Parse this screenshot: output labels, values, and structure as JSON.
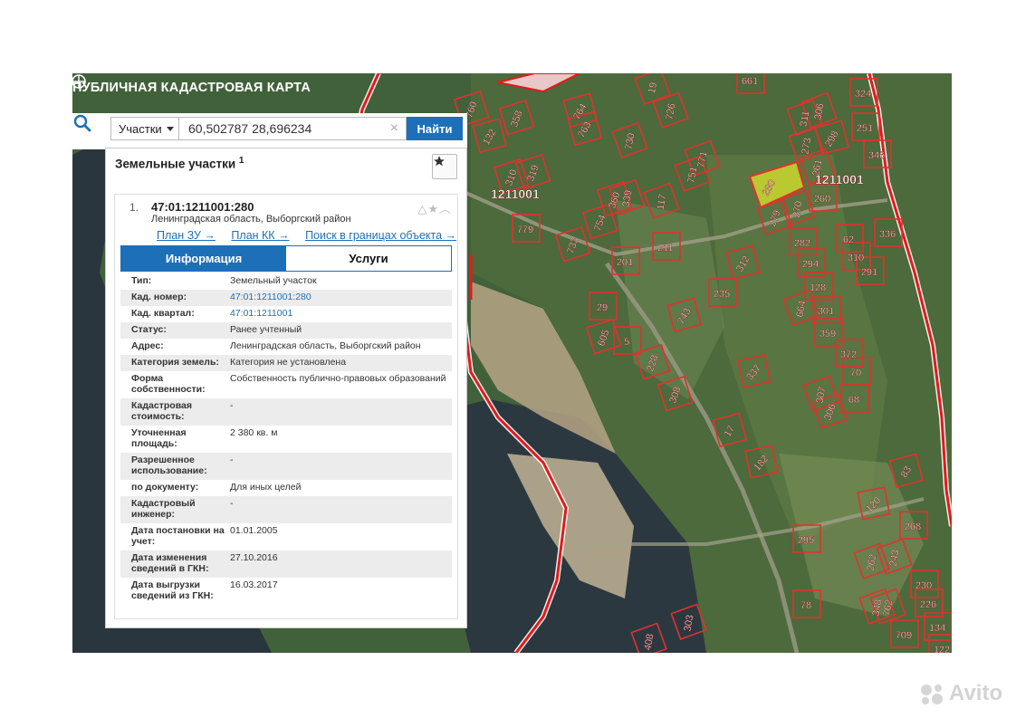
{
  "header": {
    "title": "ПУБЛИЧНАЯ КАДАСТРОВАЯ КАРТА"
  },
  "search": {
    "type_label": "Участки",
    "query": "60,502787 28,696234",
    "clear_symbol": "×",
    "find_label": "Найти"
  },
  "panel": {
    "title": "Земельные участки",
    "count": "1",
    "item": {
      "index": "1.",
      "cadastral_number": "47:01:1211001:280",
      "region": "Ленинградская область, Выборгский район",
      "links": [
        "План ЗУ →",
        "План КК →",
        "Поиск в границах объекта →"
      ]
    },
    "tabs": [
      "Информация",
      "Услуги"
    ],
    "rows": [
      {
        "k": "Тип:",
        "v": "Земельный участок"
      },
      {
        "k": "Кад. номер:",
        "v": "47:01:1211001:280"
      },
      {
        "k": "Кад. квартал:",
        "v": "47:01:1211001"
      },
      {
        "k": "Статус:",
        "v": "Ранее учтенный"
      },
      {
        "k": "Адрес:",
        "v": "Ленинградская область, Выборгский район"
      },
      {
        "k": "Категория земель:",
        "v": "Категория не установлена"
      },
      {
        "k": "Форма собственности:",
        "v": "Собственность публично-правовых образований"
      },
      {
        "k": "Кадастровая стоимость:",
        "v": "-"
      },
      {
        "k": "Уточненная площадь:",
        "v": "2 380 кв. м"
      },
      {
        "k": "Разрешенное использование:",
        "v": "-"
      },
      {
        "k": "по документу:",
        "v": "Для иных целей"
      },
      {
        "k": "Кадастровый инженер:",
        "v": "-"
      },
      {
        "k": "Дата постановки на учет:",
        "v": "01.01.2005"
      },
      {
        "k": "Дата изменения сведений в ГКН:",
        "v": "27.10.2016"
      },
      {
        "k": "Дата выгрузки сведений из ГКН:",
        "v": "16.03.2017"
      }
    ]
  },
  "map": {
    "block_labels": [
      "1211001",
      "1211001"
    ],
    "selected_parcel": "280",
    "parcel_labels": [
      "661",
      "19",
      "726",
      "764",
      "763",
      "730",
      "771",
      "751",
      "760",
      "132",
      "358",
      "310",
      "319",
      "779",
      "754",
      "360",
      "339",
      "117",
      "733",
      "211",
      "201",
      "312",
      "29",
      "235",
      "743",
      "605",
      "5",
      "228",
      "308",
      "337",
      "17",
      "182",
      "324",
      "311",
      "306",
      "251",
      "273",
      "298",
      "346",
      "261",
      "260",
      "279",
      "270",
      "282",
      "62",
      "336",
      "294",
      "310",
      "291",
      "128",
      "664",
      "301",
      "359",
      "372",
      "70",
      "307",
      "68",
      "306",
      "83",
      "120",
      "268",
      "295",
      "78",
      "262",
      "243",
      "230",
      "348",
      "226",
      "134",
      "709",
      "762",
      "303",
      "408",
      "122"
    ],
    "colors": {
      "parcel_outline": "#e0322e",
      "boundary": "#e21a1a",
      "selected_fill": "#d9e62a",
      "water": "#2c3a44",
      "forest": "#3d5a2f"
    }
  },
  "watermark": {
    "text": "Avito"
  }
}
